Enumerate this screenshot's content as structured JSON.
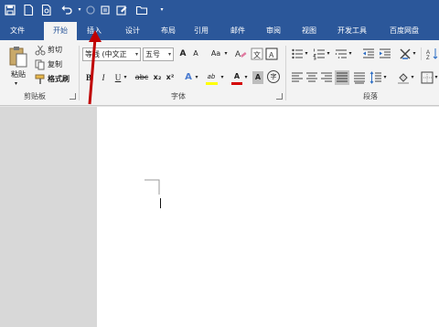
{
  "tabs": [
    "文件",
    "开始",
    "插入",
    "设计",
    "布局",
    "引用",
    "邮件",
    "审阅",
    "视图",
    "开发工具",
    "百度网盘"
  ],
  "clipboard": {
    "paste_label": "粘贴",
    "cut_label": "剪切",
    "copy_label": "复制",
    "format_painter_label": "格式刷",
    "group_label": "剪贴板"
  },
  "font": {
    "name_value": "等线 (中文正",
    "size_value": "五号",
    "group_label": "字体",
    "grow_label": "A",
    "shrink_label": "A",
    "case_label": "Aa",
    "bold_label": "B",
    "italic_label": "I",
    "underline_label": "U",
    "strike_label": "abc",
    "subscript_label": "x₂",
    "superscript_label": "x²",
    "effects_label": "A",
    "highlight_label": "ab",
    "color_label": "A",
    "charshade_label": "A",
    "enclose_label": "字"
  },
  "paragraph": {
    "group_label": "段落"
  },
  "colors": {
    "brand": "#2b579a",
    "highlight": "#ffff00",
    "font_color": "#d40000",
    "arrow": "#c00000"
  }
}
